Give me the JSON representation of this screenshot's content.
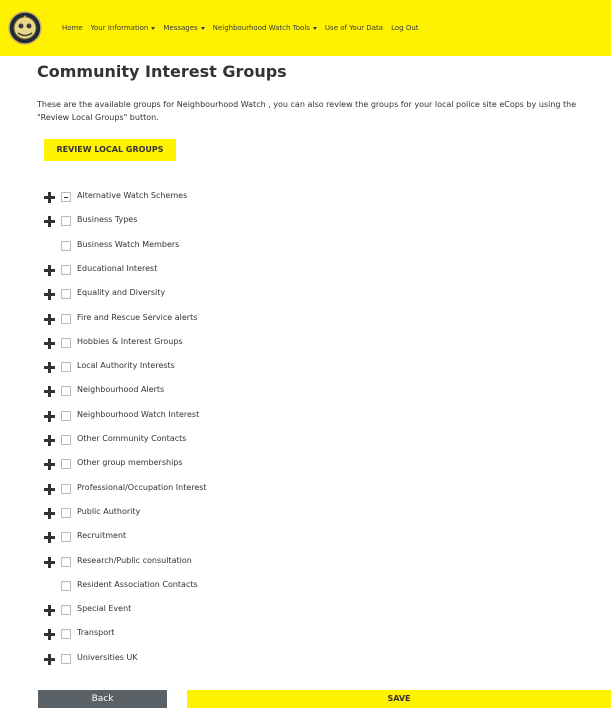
{
  "nav": {
    "items": [
      {
        "label": "Home",
        "dropdown": false
      },
      {
        "label": "Your Information",
        "dropdown": true
      },
      {
        "label": "Messages",
        "dropdown": true
      },
      {
        "label": "Neighbourhood Watch Tools",
        "dropdown": true
      },
      {
        "label": "Use of Your Data",
        "dropdown": false
      },
      {
        "label": "Log Out",
        "dropdown": false
      }
    ]
  },
  "page": {
    "title": "Community Interest Groups",
    "intro": "These are the available groups for Neighbourhood Watch , you can also review the groups for your local police site eCops by using the \"Review Local Groups\" button.",
    "review_button": "REVIEW LOCAL GROUPS"
  },
  "groups": [
    {
      "label": "Alternative Watch Schemes",
      "expandable": true,
      "state": "indeterminate"
    },
    {
      "label": "Business Types",
      "expandable": true,
      "state": "unchecked"
    },
    {
      "label": "Business Watch Members",
      "expandable": false,
      "state": "unchecked"
    },
    {
      "label": "Educational Interest",
      "expandable": true,
      "state": "unchecked"
    },
    {
      "label": "Equality and Diversity",
      "expandable": true,
      "state": "unchecked"
    },
    {
      "label": "Fire and Rescue Service alerts",
      "expandable": true,
      "state": "unchecked"
    },
    {
      "label": "Hobbies & Interest Groups",
      "expandable": true,
      "state": "unchecked"
    },
    {
      "label": "Local Authority Interests",
      "expandable": true,
      "state": "unchecked"
    },
    {
      "label": "Neighbourhood Alerts",
      "expandable": true,
      "state": "unchecked"
    },
    {
      "label": "Neighbourhood Watch Interest",
      "expandable": true,
      "state": "unchecked"
    },
    {
      "label": "Other Community Contacts",
      "expandable": true,
      "state": "unchecked"
    },
    {
      "label": "Other group memberships",
      "expandable": true,
      "state": "unchecked"
    },
    {
      "label": "Professional/Occupation Interest",
      "expandable": true,
      "state": "unchecked"
    },
    {
      "label": "Public Authority",
      "expandable": true,
      "state": "unchecked"
    },
    {
      "label": "Recruitment",
      "expandable": true,
      "state": "unchecked"
    },
    {
      "label": "Research/Public consultation",
      "expandable": true,
      "state": "unchecked"
    },
    {
      "label": "Resident Association Contacts",
      "expandable": false,
      "state": "unchecked"
    },
    {
      "label": "Special Event",
      "expandable": true,
      "state": "unchecked"
    },
    {
      "label": "Transport",
      "expandable": true,
      "state": "unchecked"
    },
    {
      "label": "Universities UK",
      "expandable": true,
      "state": "unchecked"
    }
  ],
  "footer": {
    "back_label": "Back",
    "save_label": "SAVE"
  },
  "colors": {
    "brand_yellow": "#fff200",
    "back_gray": "#5a6268",
    "text": "#333333"
  },
  "icons": {
    "logo": "neighbourhood-watch-logo",
    "expand": "plus-icon",
    "dropdown": "caret-down-icon"
  }
}
